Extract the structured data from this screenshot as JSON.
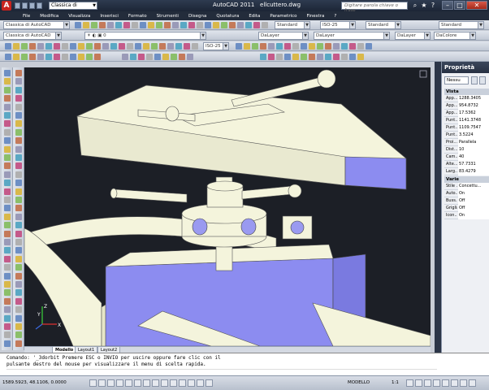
{
  "titlebar": {
    "workspace": "Classica di AutoCAD",
    "app_title": "AutoCAD 2011",
    "file_name": "ellcuttero.dwg",
    "search_placeholder": "Digitare parola chiave o frase"
  },
  "menu": [
    "File",
    "Modifica",
    "Visualizza",
    "Inserisci",
    "Formato",
    "Strumenti",
    "Disegna",
    "Quotatura",
    "Edita",
    "Parametrico",
    "Finestra",
    "?"
  ],
  "toolbars": {
    "workspace_combo": "Classica di AutoCAD",
    "style_combo_1": "Standard",
    "iso_combo": "ISO-25",
    "style_combo_2": "Standard",
    "style_combo_3": "Standard",
    "layer_combo_1": "DaLayer",
    "layer_combo_2": "DaLayer",
    "layer_combo_3": "DaLayer",
    "color_combo": "DaColore"
  },
  "viewport": {
    "background_color": "#1c1f26",
    "model_color": "#f4f4dc",
    "shade_color": "#8c8cf0",
    "ucs_labels": [
      "Z",
      "Y",
      "X"
    ]
  },
  "tabs": [
    "Modello",
    "Layout1",
    "Layout2"
  ],
  "command": {
    "line1": "Comando: '_3dorbit Premere ESC o INVIO per uscire oppure fare clic con il",
    "line2": "pulsante destro del mouse per visualizzare il menu di scelta rapida."
  },
  "status": {
    "coords": "1589.5923, 48.1106, 0.0000",
    "model": "MODELLO",
    "scale": "1:1"
  },
  "properties": {
    "title": "Proprietà",
    "selection": "Nessu",
    "section_view": "Vista",
    "view_rows": [
      {
        "name": "App...",
        "value": "1288.3405"
      },
      {
        "name": "App...",
        "value": "954.8732"
      },
      {
        "name": "App...",
        "value": "17.5362"
      },
      {
        "name": "Punt...",
        "value": "1141.3748"
      },
      {
        "name": "Punt...",
        "value": "1109.7547"
      },
      {
        "name": "Punt...",
        "value": "3.5224"
      },
      {
        "name": "Proi...",
        "value": "Parallela"
      },
      {
        "name": "Dist...",
        "value": "10"
      },
      {
        "name": "Cam...",
        "value": "40"
      },
      {
        "name": "Alte...",
        "value": "57.7331"
      },
      {
        "name": "Larg...",
        "value": "83.4279"
      }
    ],
    "section_misc": "Varie",
    "misc_rows": [
      {
        "name": "Stile ...",
        "value": "Concettu..."
      },
      {
        "name": "Auto...",
        "value": "On"
      },
      {
        "name": "Buss...",
        "value": "Off"
      },
      {
        "name": "Griglia",
        "value": "Off"
      },
      {
        "name": "Icon...",
        "value": "On"
      }
    ]
  }
}
